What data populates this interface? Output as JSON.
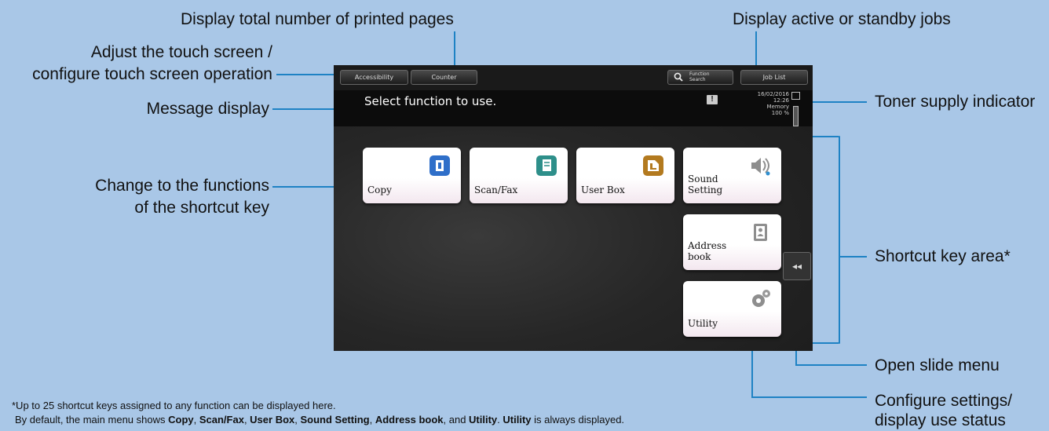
{
  "callouts": {
    "total_pages": "Display total number of printed pages",
    "active_jobs": "Display active or standby jobs",
    "adjust_line1": "Adjust the touch screen /",
    "adjust_line2": "configure touch screen operation",
    "message_display": "Message display",
    "toner_indicator": "Toner supply indicator",
    "change_line1": "Change to the functions",
    "change_line2": "of the shortcut key",
    "shortcut_area": "Shortcut key area*",
    "open_slide": "Open slide menu",
    "configure_line1": "Configure settings/",
    "configure_line2": "display use status"
  },
  "panel": {
    "accessibility": "Accessibility",
    "counter": "Counter",
    "function_search_1": "Function",
    "function_search_2": "Search",
    "job_list": "Job List",
    "message": "Select function to use.",
    "date": "16/02/2016",
    "time": "12:26",
    "memory_label": "Memory",
    "memory_value": "100 %",
    "warning_symbol": "!",
    "slide_symbol": "◂◂"
  },
  "shortcuts": [
    {
      "label": "Copy",
      "icon": "copy-icon",
      "color": "#2f6fc9"
    },
    {
      "label": "Scan/Fax",
      "icon": "scan-fax-icon",
      "color": "#2e8f8a"
    },
    {
      "label": "User Box",
      "icon": "user-box-icon",
      "color": "#b37a1f"
    },
    {
      "label": "Sound\nSetting",
      "icon": "speaker-icon",
      "color": "#8e8e8e"
    },
    {
      "label": "Address\nbook",
      "icon": "address-book-icon",
      "color": "#8e8e8e"
    },
    {
      "label": "Utility",
      "icon": "gear-icon",
      "color": "#8e8e8e"
    }
  ],
  "footnote": {
    "line1": "*Up to 25 shortcut keys assigned to any function can be displayed here.",
    "l2_a": "By default, the main menu shows ",
    "l2_copy": "Copy",
    "l2_sep1": ", ",
    "l2_scan": "Scan/Fax",
    "l2_sep2": ", ",
    "l2_userbox": "User Box",
    "l2_sep3": ", ",
    "l2_sound": "Sound Setting",
    "l2_sep4": ", ",
    "l2_address": "Address book",
    "l2_sep5": ", and ",
    "l2_utility": "Utility",
    "l2_sep6": ". ",
    "l2_utility2": "Utility",
    "l2_end": " is always displayed."
  }
}
